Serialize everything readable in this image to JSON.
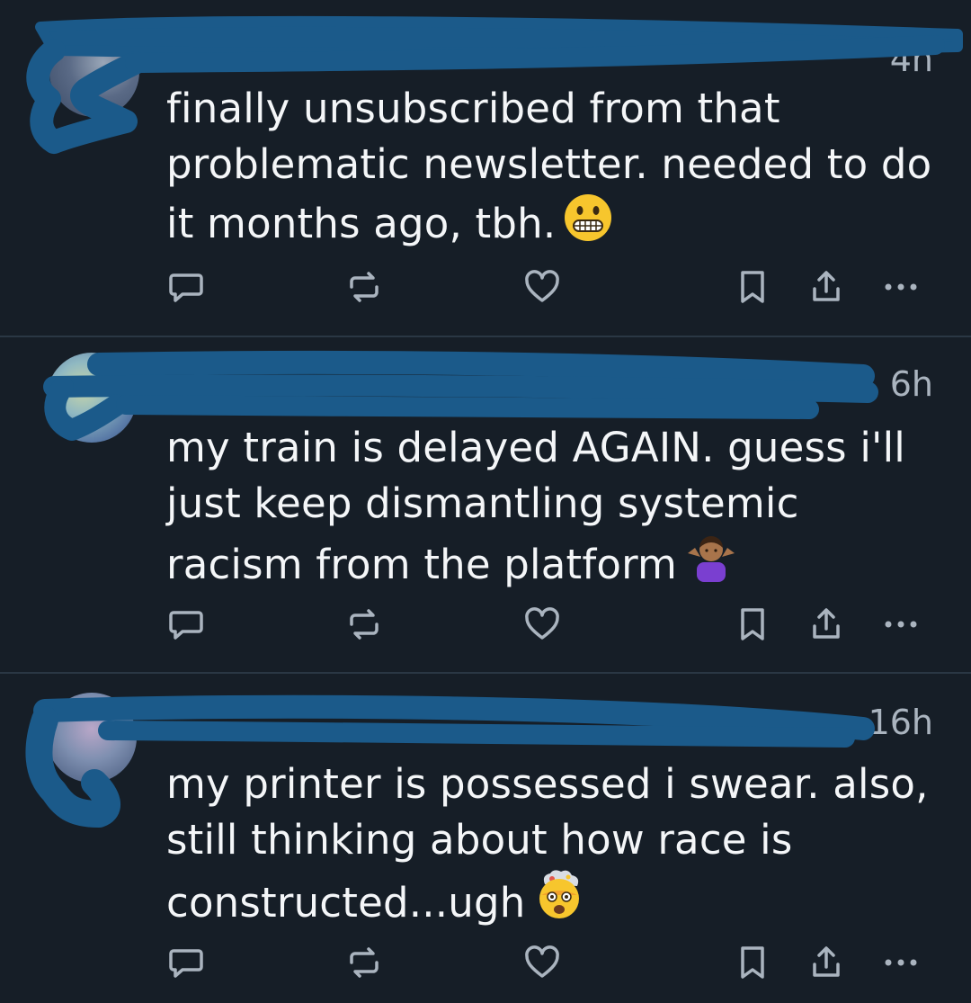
{
  "posts": [
    {
      "time": "4h",
      "text": "finally unsubscribed from that problematic newsletter. needed to do it months ago, tbh.",
      "emoji": "grimacing-face"
    },
    {
      "time": "6h",
      "text": "my train is delayed AGAIN. guess i'll just keep dismantling systemic racism from the platform",
      "emoji": "person-shrugging"
    },
    {
      "time": "16h",
      "text": "my printer is possessed i swear. also, still thinking about how race is constructed...ugh",
      "emoji": "exploding-head"
    }
  ],
  "icons": {
    "reply": "reply-icon",
    "repost": "repost-icon",
    "like": "heart-icon",
    "bookmark": "bookmark-icon",
    "share": "share-icon",
    "more": "more-icon"
  },
  "colors": {
    "background": "#161e27",
    "text": "#f4f6f8",
    "muted": "#aab4bf",
    "redaction": "#1b5a8a"
  }
}
